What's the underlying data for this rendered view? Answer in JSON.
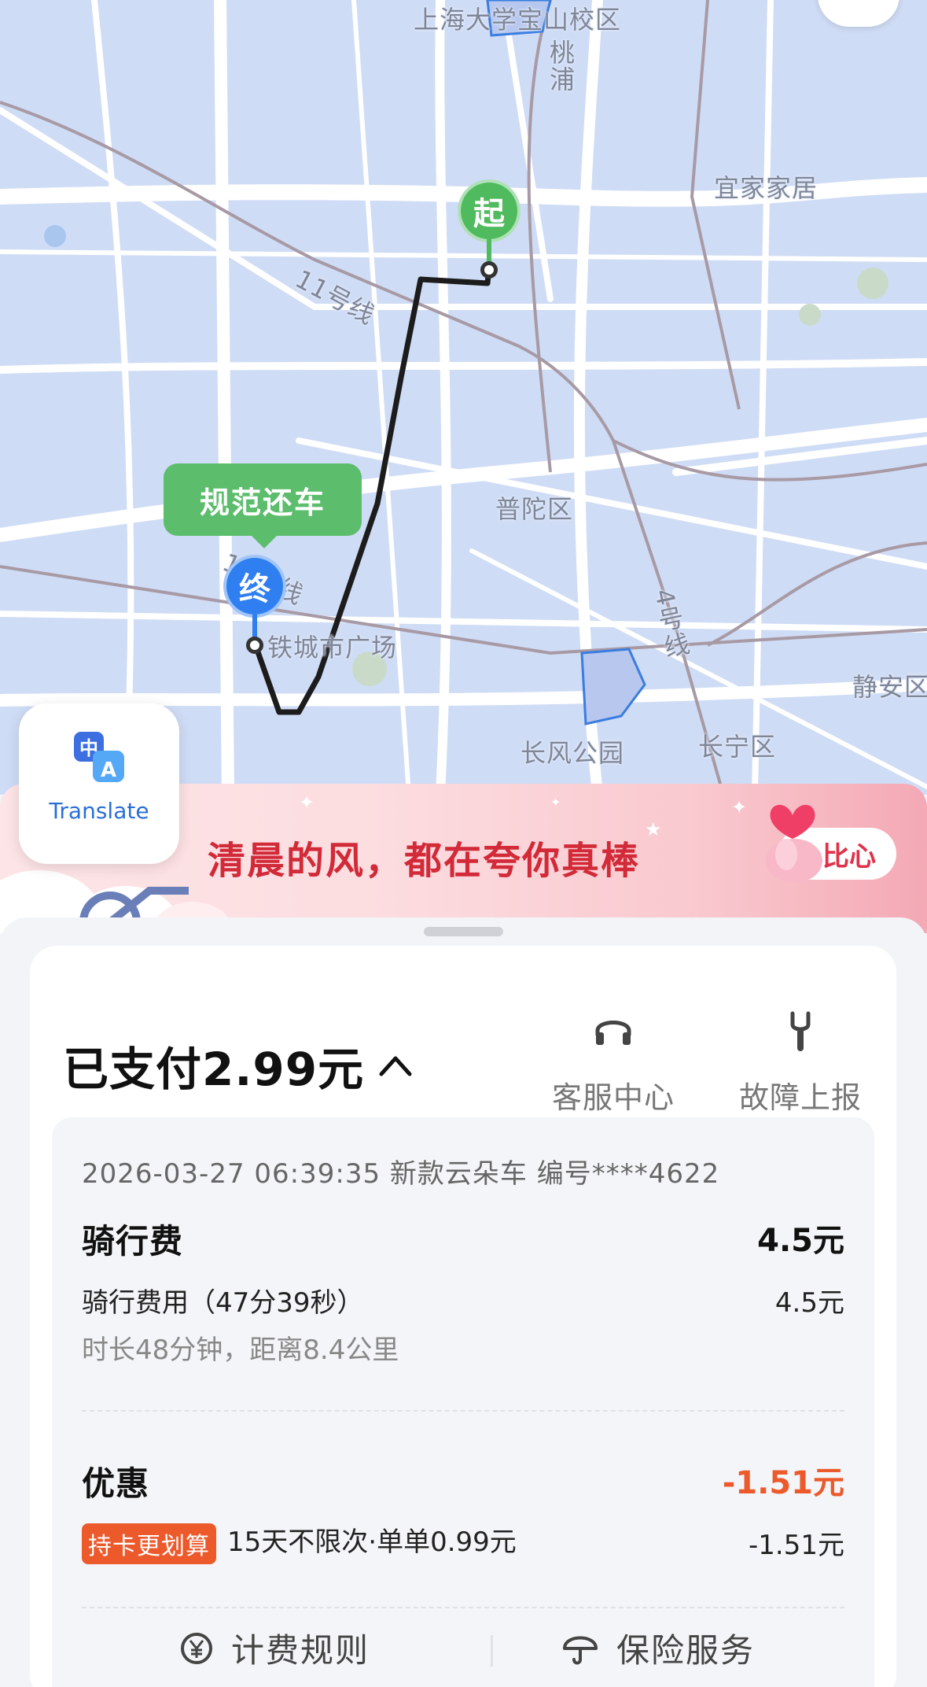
{
  "map": {
    "labels": {
      "campus": "上海大学宝山校区",
      "taopu": "桃浦",
      "yijia": "宜家家居",
      "line11": "11号线",
      "putuo": "普陀区",
      "line13": "13号线",
      "tiecheng": "铁城市广场",
      "line4": "4号线",
      "jingan": "静安区",
      "changfeng": "长风公园",
      "changning": "长宁区"
    },
    "start_pin": "起",
    "end_pin": "终",
    "return_tag": "规范还车",
    "colors": {
      "start": "#4fba5e",
      "end": "#2f7ff0",
      "route": "#1c1c1c"
    }
  },
  "translate": {
    "label": "Translate",
    "icon_text_1": "中",
    "icon_text_2": "A"
  },
  "banner": {
    "slogan": "清晨的风，都在夸你真棒",
    "heart_button": "比心"
  },
  "summary": {
    "paid": "已支付2.99元",
    "actions": [
      {
        "label": "客服中心",
        "icon": "headset-icon"
      },
      {
        "label": "故障上报",
        "icon": "wrench-icon"
      }
    ]
  },
  "detail": {
    "meta": "2026-03-27 06:39:35 新款云朵车 编号****4622",
    "ride": {
      "title": "骑行费",
      "amount": "4.5元",
      "item_label": "骑行费用（47分39秒）",
      "item_value": "4.5元",
      "sub": "时长48分钟，距离8.4公里"
    },
    "discount": {
      "title": "优惠",
      "amount": "-1.51元",
      "badge": "持卡更划算",
      "item_label": "15天不限次·单单0.99元",
      "item_value": "-1.51元"
    },
    "links": [
      {
        "label": "计费规则",
        "icon": "yuan-circle-icon"
      },
      {
        "label": "保险服务",
        "icon": "umbrella-icon"
      }
    ]
  }
}
